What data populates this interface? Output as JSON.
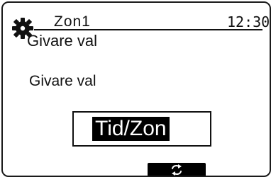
{
  "header": {
    "icon": "gear-icon",
    "zone": "Zon1",
    "time": "12:30",
    "title": "Givare val"
  },
  "main": {
    "field_label": "Givare val",
    "selected_value": "Tid/Zon"
  },
  "footer": {
    "button_icon": "refresh-icon"
  },
  "colors": {
    "foreground": "#111111",
    "background": "#ffffff",
    "highlight": "#000000"
  }
}
